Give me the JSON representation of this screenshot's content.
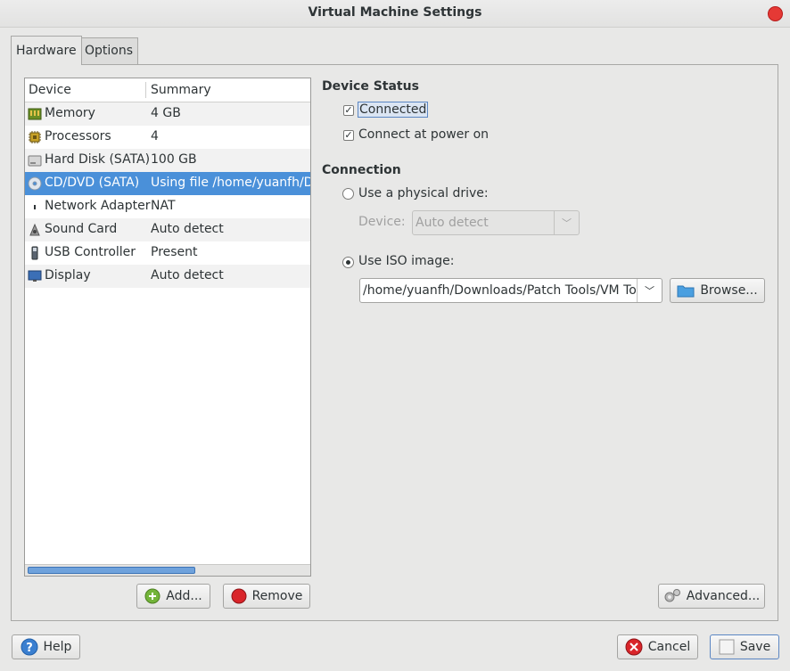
{
  "window": {
    "title": "Virtual Machine Settings"
  },
  "tabs": [
    {
      "label": "Hardware",
      "active": true
    },
    {
      "label": "Options",
      "active": false
    }
  ],
  "device_list": {
    "columns": [
      "Device",
      "Summary"
    ],
    "rows": [
      {
        "device": "Memory",
        "summary": "4 GB",
        "icon": "memory-icon"
      },
      {
        "device": "Processors",
        "summary": "4",
        "icon": "processor-icon"
      },
      {
        "device": "Hard Disk (SATA)",
        "summary": "100 GB",
        "icon": "hard-disk-icon"
      },
      {
        "device": "CD/DVD (SATA)",
        "summary": "Using file /home/yuanfh/Dow",
        "icon": "cd-dvd-icon",
        "selected": true
      },
      {
        "device": "Network Adapter",
        "summary": "NAT",
        "icon": "network-icon"
      },
      {
        "device": "Sound Card",
        "summary": "Auto detect",
        "icon": "sound-icon"
      },
      {
        "device": "USB Controller",
        "summary": "Present",
        "icon": "usb-icon"
      },
      {
        "device": "Display",
        "summary": "Auto detect",
        "icon": "display-icon"
      }
    ]
  },
  "list_buttons": {
    "add": "Add...",
    "remove": "Remove"
  },
  "device_status": {
    "title": "Device Status",
    "connected": {
      "label": "Connected",
      "checked": true
    },
    "connect_at_power_on": {
      "label": "Connect at power on",
      "checked": true
    }
  },
  "connection": {
    "title": "Connection",
    "physical_drive": {
      "label": "Use a physical drive:",
      "selected": false
    },
    "device_label": "Device:",
    "device_value": "Auto detect",
    "iso": {
      "label": "Use ISO image:",
      "selected": true
    },
    "iso_path": "/home/yuanfh/Downloads/Patch Tools/VM Tool",
    "browse": "Browse..."
  },
  "advanced": "Advanced...",
  "footer": {
    "help": "Help",
    "cancel": "Cancel",
    "save": "Save"
  },
  "colors": {
    "selection": "#4a90d9",
    "close": "#e53935"
  }
}
